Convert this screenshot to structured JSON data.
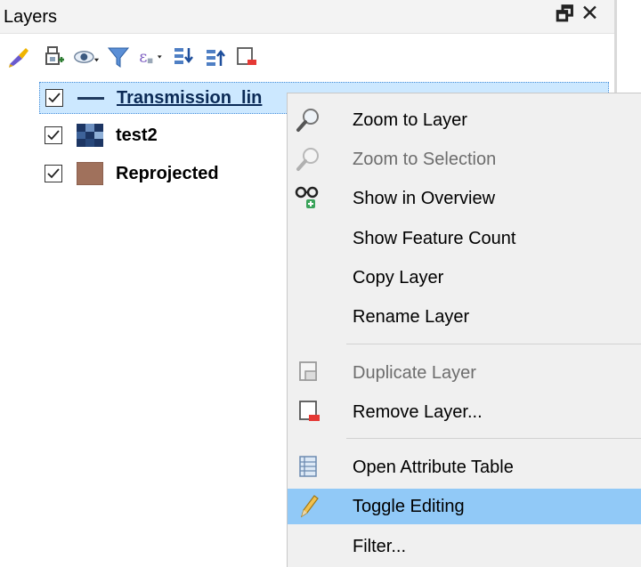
{
  "panel": {
    "title": "Layers",
    "float_glyph": "🗗",
    "close_glyph": "✕",
    "toolbar_icons": [
      "style-manager-icon",
      "add-group-icon",
      "manage-visibility-icon",
      "filter-legend-icon",
      "filter-expression-icon",
      "expand-all-icon",
      "collapse-all-icon",
      "remove-layer-icon"
    ]
  },
  "layers": [
    {
      "name": "Transmission_lin",
      "checked": true,
      "symbol": "line-symbol-icon",
      "selected": true
    },
    {
      "name": "test2",
      "checked": true,
      "symbol": "raster-symbol-icon",
      "selected": false
    },
    {
      "name": "Reprojected",
      "checked": true,
      "symbol": "polygon-fill-symbol-icon",
      "fill_color": "#a0715c",
      "selected": false
    }
  ],
  "context_menu": {
    "items": [
      {
        "label": "Zoom to Layer",
        "icon": "zoom-icon",
        "enabled": true
      },
      {
        "label": "Zoom to Selection",
        "icon": "zoom-icon",
        "enabled": false
      },
      {
        "label": "Show in Overview",
        "icon": "overview-icon",
        "enabled": true
      },
      {
        "label": "Show Feature Count",
        "icon": "",
        "enabled": true
      },
      {
        "label": "Copy Layer",
        "icon": "",
        "enabled": true
      },
      {
        "label": "Rename Layer",
        "icon": "",
        "enabled": true
      },
      {
        "label": "Duplicate Layer",
        "icon": "duplicate-icon",
        "enabled": false
      },
      {
        "label": "Remove Layer...",
        "icon": "remove-layer-icon",
        "enabled": true
      },
      {
        "label": "Open Attribute Table",
        "icon": "attribute-table-icon",
        "enabled": true
      },
      {
        "label": "Toggle Editing",
        "icon": "pencil-icon",
        "enabled": true,
        "highlighted": true
      },
      {
        "label": "Filter...",
        "icon": "",
        "enabled": true
      }
    ]
  },
  "colors": {
    "selection_bg": "#cce8ff",
    "menu_bg": "#f0f0f0",
    "menu_hover": "#91c9f7",
    "disabled_text": "#6d6d6d"
  }
}
